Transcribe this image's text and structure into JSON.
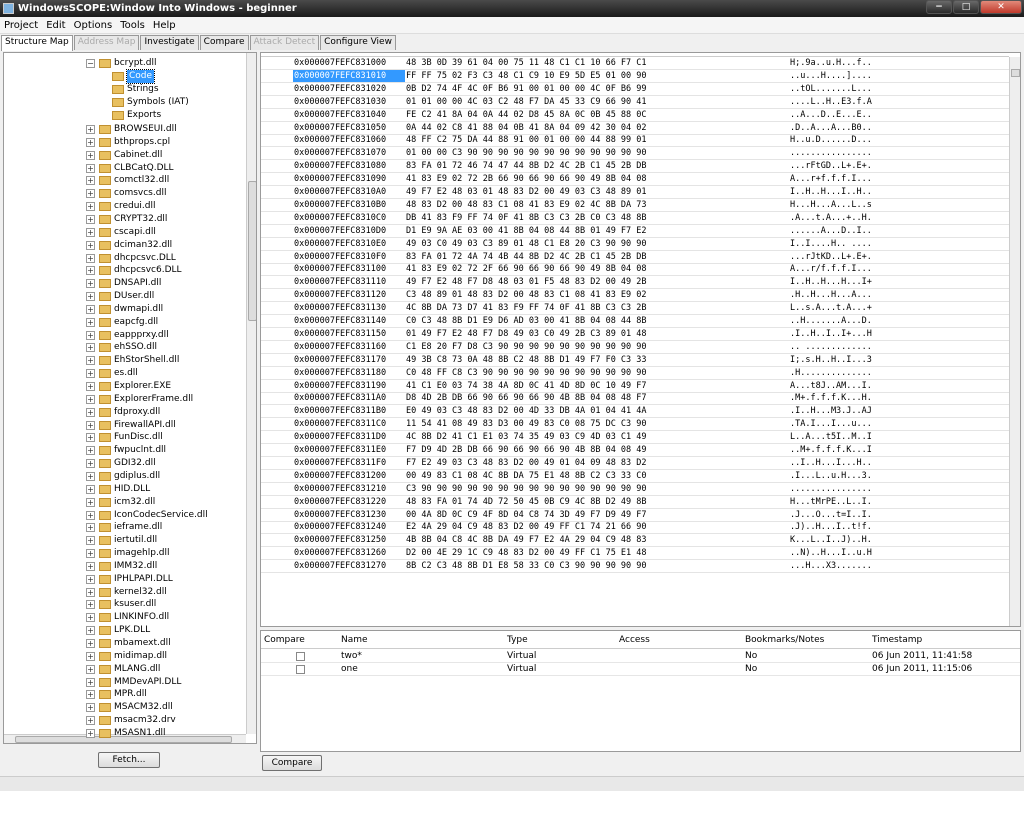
{
  "window": {
    "title": "WindowsSCOPE:Window Into Windows - beginner",
    "min": "−",
    "max": "□",
    "close": "✕"
  },
  "menu": [
    "Project",
    "Edit",
    "Options",
    "Tools",
    "Help"
  ],
  "tabs": [
    {
      "label": "Structure Map",
      "active": true,
      "enabled": true
    },
    {
      "label": "Address Map",
      "active": false,
      "enabled": false
    },
    {
      "label": "Investigate",
      "active": false,
      "enabled": true
    },
    {
      "label": "Compare",
      "active": false,
      "enabled": true
    },
    {
      "label": "Attack Detect",
      "active": false,
      "enabled": false
    },
    {
      "label": "Configure View",
      "active": false,
      "enabled": true
    }
  ],
  "tree": {
    "expanded": {
      "label": "bcrypt.dll",
      "children": [
        "Code",
        "Strings",
        "Symbols (IAT)",
        "Exports"
      ],
      "selected": "Code"
    },
    "items": [
      "BROWSEUI.dll",
      "bthprops.cpl",
      "Cabinet.dll",
      "CLBCatQ.DLL",
      "comctl32.dll",
      "comsvcs.dll",
      "credui.dll",
      "CRYPT32.dll",
      "cscapi.dll",
      "dciman32.dll",
      "dhcpcsvc.DLL",
      "dhcpcsvc6.DLL",
      "DNSAPI.dll",
      "DUser.dll",
      "dwmapi.dll",
      "eapcfg.dll",
      "eappprxy.dll",
      "ehSSO.dll",
      "EhStorShell.dll",
      "es.dll",
      "Explorer.EXE",
      "ExplorerFrame.dll",
      "fdproxy.dll",
      "FirewallAPI.dll",
      "FunDisc.dll",
      "fwpuclnt.dll",
      "GDI32.dll",
      "gdiplus.dll",
      "HID.DLL",
      "icm32.dll",
      "IconCodecService.dll",
      "ieframe.dll",
      "iertutil.dll",
      "imagehlp.dll",
      "IMM32.dll",
      "IPHLPAPI.DLL",
      "kernel32.dll",
      "ksuser.dll",
      "LINKINFO.dll",
      "LPK.DLL",
      "mbamext.dll",
      "midimap.dll",
      "MLANG.dll",
      "MMDevAPI.DLL",
      "MPR.dll",
      "MSACM32.dll",
      "msacm32.drv",
      "MSASN1.dll"
    ]
  },
  "buttons": {
    "fetch": "Fetch...",
    "compare": "Compare"
  },
  "hex": [
    {
      "addr": "0x000007FEFC831000",
      "bytes": "48 3B 0D 39 61 04 00 75 11 48 C1 C1 10 66 F7 C1",
      "ascii": "H;.9a..u.H...f.."
    },
    {
      "addr": "0x000007FEFC831010",
      "bytes": "FF FF 75 02 F3 C3 48 C1 C9 10 E9 5D E5 01 00 90",
      "ascii": "..u...H....]....",
      "selected": true
    },
    {
      "addr": "0x000007FEFC831020",
      "bytes": "0B D2 74 4F 4C 0F B6 91 00 01 00 00 4C 0F B6 99",
      "ascii": "..tOL.......L..."
    },
    {
      "addr": "0x000007FEFC831030",
      "bytes": "01 01 00 00 4C 03 C2 48 F7 DA 45 33 C9 66 90 41",
      "ascii": "....L..H..E3.f.A"
    },
    {
      "addr": "0x000007FEFC831040",
      "bytes": "FE C2 41 8A 04 0A 44 02 D8 45 8A 0C 0B 45 88 0C",
      "ascii": "..A...D..E...E.."
    },
    {
      "addr": "0x000007FEFC831050",
      "bytes": "0A 44 02 C8 41 88 04 0B 41 8A 04 09 42 30 04 02",
      "ascii": ".D..A...A...B0.."
    },
    {
      "addr": "0x000007FEFC831060",
      "bytes": "48 FF C2 75 DA 44 88 91 00 01 00 00 44 88 99 01",
      "ascii": "H..u.D......D..."
    },
    {
      "addr": "0x000007FEFC831070",
      "bytes": "01 00 00 C3 90 90 90 90 90 90 90 90 90 90 90 90",
      "ascii": "................"
    },
    {
      "addr": "0x000007FEFC831080",
      "bytes": "83 FA 01 72 46 74 47 44 8B D2 4C 2B C1 45 2B DB",
      "ascii": "...rFtGD..L+.E+."
    },
    {
      "addr": "0x000007FEFC831090",
      "bytes": "41 83 E9 02 72 2B 66 90 66 90 66 90 49 8B 04 08",
      "ascii": "A...r+f.f.f.I..."
    },
    {
      "addr": "0x000007FEFC8310A0",
      "bytes": "49 F7 E2 48 03 01 48 83 D2 00 49 03 C3 48 89 01",
      "ascii": "I..H..H...I..H.."
    },
    {
      "addr": "0x000007FEFC8310B0",
      "bytes": "48 83 D2 00 48 83 C1 08 41 83 E9 02 4C 8B DA 73",
      "ascii": "H...H...A...L..s"
    },
    {
      "addr": "0x000007FEFC8310C0",
      "bytes": "DB 41 83 F9 FF 74 0F 41 8B C3 C3 2B C0 C3 48 8B",
      "ascii": ".A...t.A...+..H."
    },
    {
      "addr": "0x000007FEFC8310D0",
      "bytes": "D1 E9 9A AE 03 00 41 8B 04 08 44 8B 01 49 F7 E2",
      "ascii": "......A...D..I.."
    },
    {
      "addr": "0x000007FEFC8310E0",
      "bytes": "49 03 C0 49 03 C3 89 01 48 C1 E8 20 C3 90 90 90",
      "ascii": "I..I....H.. ...."
    },
    {
      "addr": "0x000007FEFC8310F0",
      "bytes": "83 FA 01 72 4A 74 4B 44 8B D2 4C 2B C1 45 2B DB",
      "ascii": "...rJtKD..L+.E+."
    },
    {
      "addr": "0x000007FEFC831100",
      "bytes": "41 83 E9 02 72 2F 66 90 66 90 66 90 49 8B 04 08",
      "ascii": "A...r/f.f.f.I..."
    },
    {
      "addr": "0x000007FEFC831110",
      "bytes": "49 F7 E2 48 F7 D8 48 03 01 F5 48 83 D2 00 49 2B",
      "ascii": "I..H..H...H...I+"
    },
    {
      "addr": "0x000007FEFC831120",
      "bytes": "C3 48 89 01 48 83 D2 00 48 83 C1 08 41 83 E9 02",
      "ascii": ".H..H...H...A..."
    },
    {
      "addr": "0x000007FEFC831130",
      "bytes": "4C 8B DA 73 D7 41 83 F9 FF 74 0F 41 8B C3 C3 2B",
      "ascii": "L..s.A...t.A...+"
    },
    {
      "addr": "0x000007FEFC831140",
      "bytes": "C0 C3 48 8B D1 E9 D6 AD 03 00 41 8B 04 08 44 8B",
      "ascii": "..H.......A...D."
    },
    {
      "addr": "0x000007FEFC831150",
      "bytes": "01 49 F7 E2 48 F7 D8 49 03 C0 49 2B C3 89 01 48",
      "ascii": ".I..H..I..I+...H"
    },
    {
      "addr": "0x000007FEFC831160",
      "bytes": "C1 E8 20 F7 D8 C3 90 90 90 90 90 90 90 90 90 90",
      "ascii": ".. ............."
    },
    {
      "addr": "0x000007FEFC831170",
      "bytes": "49 3B C8 73 0A 48 8B C2 48 8B D1 49 F7 F0 C3 33",
      "ascii": "I;.s.H..H..I...3"
    },
    {
      "addr": "0x000007FEFC831180",
      "bytes": "C0 48 FF C8 C3 90 90 90 90 90 90 90 90 90 90 90",
      "ascii": ".H.............."
    },
    {
      "addr": "0x000007FEFC831190",
      "bytes": "41 C1 E0 03 74 38 4A 8D 0C 41 4D 8D 0C 10 49 F7",
      "ascii": "A...t8J..AM...I."
    },
    {
      "addr": "0x000007FEFC8311A0",
      "bytes": "D8 4D 2B DB 66 90 66 90 66 90 4B 8B 04 08 48 F7",
      "ascii": ".M+.f.f.f.K...H."
    },
    {
      "addr": "0x000007FEFC8311B0",
      "bytes": "E0 49 03 C3 48 83 D2 00 4D 33 DB 4A 01 04 41 4A",
      "ascii": ".I..H...M3.J..AJ"
    },
    {
      "addr": "0x000007FEFC8311C0",
      "bytes": "11 54 41 08 49 83 D3 00 49 83 C0 08 75 DC C3 90",
      "ascii": ".TA.I...I...u..."
    },
    {
      "addr": "0x000007FEFC8311D0",
      "bytes": "4C 8B D2 41 C1 E1 03 74 35 49 03 C9 4D 03 C1 49",
      "ascii": "L..A...t5I..M..I"
    },
    {
      "addr": "0x000007FEFC8311E0",
      "bytes": "F7 D9 4D 2B DB 66 90 66 90 66 90 4B 8B 04 08 49",
      "ascii": "..M+.f.f.f.K...I"
    },
    {
      "addr": "0x000007FEFC8311F0",
      "bytes": "F7 E2 49 03 C3 48 83 D2 00 49 01 04 09 48 83 D2",
      "ascii": "..I..H...I...H.."
    },
    {
      "addr": "0x000007FEFC831200",
      "bytes": "00 49 83 C1 08 4C 8B DA 75 E1 48 8B C2 C3 33 C0",
      "ascii": ".I...L..u.H...3."
    },
    {
      "addr": "0x000007FEFC831210",
      "bytes": "C3 90 90 90 90 90 90 90 90 90 90 90 90 90 90 90",
      "ascii": "................"
    },
    {
      "addr": "0x000007FEFC831220",
      "bytes": "48 83 FA 01 74 4D 72 50 45 0B C9 4C 8B D2 49 8B",
      "ascii": "H...tMrPE..L..I."
    },
    {
      "addr": "0x000007FEFC831230",
      "bytes": "00 4A 8D 0C C9 4F 8D 04 C8 74 3D 49 F7 D9 49 F7",
      "ascii": ".J...O...t=I..I."
    },
    {
      "addr": "0x000007FEFC831240",
      "bytes": "E2 4A 29 04 C9 48 83 D2 00 49 FF C1 74 21 66 90",
      "ascii": ".J)..H...I..t!f."
    },
    {
      "addr": "0x000007FEFC831250",
      "bytes": "4B 8B 04 C8 4C 8B DA 49 F7 E2 4A 29 04 C9 48 83",
      "ascii": "K...L..I..J)..H."
    },
    {
      "addr": "0x000007FEFC831260",
      "bytes": "D2 00 4E 29 1C C9 48 83 D2 00 49 FF C1 75 E1 48",
      "ascii": "..N)..H...I..u.H"
    },
    {
      "addr": "0x000007FEFC831270",
      "bytes": "8B C2 C3 48 8B D1 E8 58 33 C0 C3 90 90 90 90 90",
      "ascii": "...H...X3......."
    }
  ],
  "compare_table": {
    "headers": [
      "Compare",
      "Name",
      "Type",
      "Access",
      "Bookmarks/Notes",
      "Timestamp"
    ],
    "rows": [
      {
        "name": "two*",
        "type": "Virtual",
        "access": "",
        "bookmarks": "No",
        "timestamp": "06 Jun 2011, 11:41:58"
      },
      {
        "name": "one",
        "type": "Virtual",
        "access": "",
        "bookmarks": "No",
        "timestamp": "06 Jun 2011, 11:15:06"
      }
    ]
  }
}
